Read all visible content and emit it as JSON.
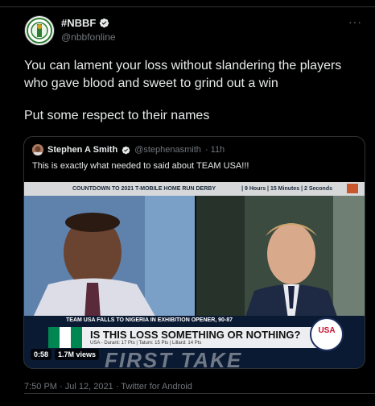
{
  "tweet": {
    "display_name": "#NBBF",
    "handle": "@nbbfonline",
    "more_label": "···",
    "paragraphs": [
      "You can lament your loss without slandering the players who gave blood and sweet to grind out a win",
      "Put some respect to their names"
    ],
    "timestamp": "7:50 PM · Jul 12, 2021 · Twitter for Android"
  },
  "quote": {
    "display_name": "Stephen A Smith",
    "handle": "@stephenasmith",
    "time": "· 11h",
    "text": "This is exactly what needed to said about TEAM USA!!!"
  },
  "video": {
    "banner_left": "COUNTDOWN TO 2021 T-MOBILE HOME RUN DERBY",
    "banner_right": "| 9 Hours | 15 Minutes | 2 Seconds",
    "lower_title": "TEAM USA FALLS TO NIGERIA IN EXHIBITION OPENER, 90-87",
    "headline": "IS THIS LOSS SOMETHING OR NOTHING?",
    "stats": "USA - Durant: 17 Pts  |  Tatum: 15 Pts  |  Lillard: 14 Pts",
    "logo_text": "USA",
    "watermark": "FIRST TAKE",
    "duration": "0:58",
    "views": "1.7M views"
  },
  "colors": {
    "background": "#000000",
    "text": "#e7e9ea",
    "muted": "#71767b",
    "verified": "#1d9bf0",
    "nigeria_green": "#008751"
  },
  "icons": {
    "verified": "verified-badge-icon",
    "more": "more-dots-icon"
  }
}
